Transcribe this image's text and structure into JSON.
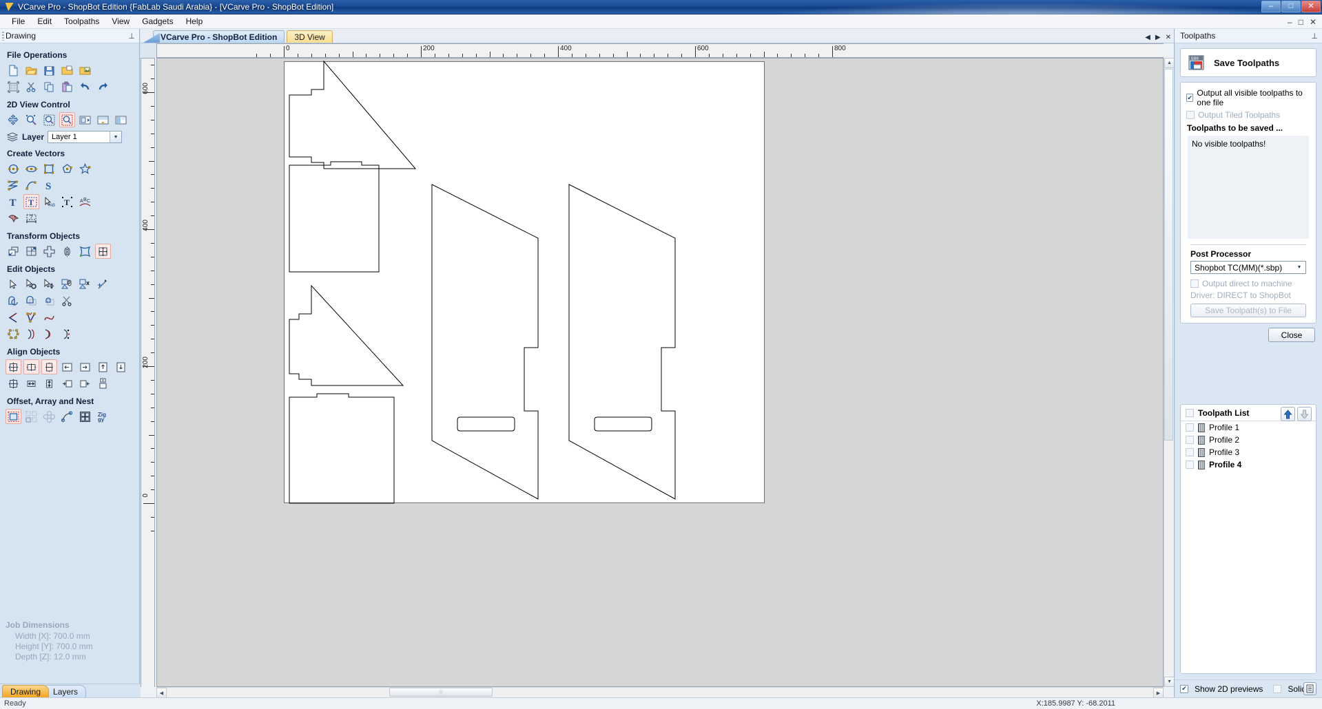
{
  "window": {
    "title": "VCarve Pro - ShopBot Edition {FabLab Saudi Arabia} - [VCarve Pro - ShopBot Edition]",
    "minimize": "–",
    "maximize": "□",
    "close": "✕",
    "inner_minimize": "–",
    "inner_maximize": "□",
    "inner_close": "✕"
  },
  "menu": {
    "items": [
      "File",
      "Edit",
      "Toolpaths",
      "View",
      "Gadgets",
      "Help"
    ]
  },
  "left_dock": {
    "title": "Drawing",
    "pin": "⊥",
    "groups": [
      {
        "title": "File Operations",
        "icons": [
          "new-file-icon",
          "open-folder-icon",
          "save-disk-icon",
          "import-folder-icon",
          "import-image-icon",
          "job-setup-icon",
          "cut-scissors-icon",
          "copy-icon",
          "paste-icon",
          "undo-icon",
          "redo-icon"
        ]
      },
      {
        "title": "2D View Control",
        "icons": [
          "pan-icon",
          "zoom-icon",
          "zoom-extents-icon",
          "zoom-box-icon",
          "zoom-selected-icon",
          "zoom-material-icon",
          "zoom-drawing-icon"
        ]
      },
      {
        "title": "Create Vectors",
        "icons": [
          "circle-icon",
          "ellipse-icon",
          "rectangle-icon",
          "polygon-icon",
          "star-icon",
          "polyline-icon",
          "curve-icon",
          "sweep-icon",
          "text-icon",
          "text-box-icon",
          "text-select-icon",
          "text-on-curve-icon",
          "text-arc-icon",
          "trace-bitmap-icon",
          "dimension-icon"
        ]
      },
      {
        "title": "Transform Objects",
        "icons": [
          "move-icon",
          "scale-icon",
          "rotate-icon",
          "mirror-icon",
          "distort-icon",
          "align-center-icon"
        ]
      },
      {
        "title": "Edit Objects",
        "icons": [
          "select-icon",
          "node-edit-icon",
          "move-node-icon",
          "group-icon",
          "ungroup-icon",
          "measure-icon",
          "weld-icon",
          "subtract-icon",
          "intersect-icon",
          "trim-icon",
          "join-vectors-icon",
          "fit-curves-icon",
          "curve-fit-icon",
          "close-vectors-icon",
          "offset-open-icon",
          "offset-curve-icon",
          "split-vector-icon"
        ]
      },
      {
        "title": "Align Objects",
        "icons": [
          "align-center-both-icon",
          "align-center-horiz-icon",
          "align-center-vert-icon",
          "align-left-icon",
          "align-right-icon",
          "align-top-icon",
          "align-bottom-icon",
          "align-mat-center-icon",
          "align-mat-horiz-icon",
          "align-mat-vert-icon",
          "align-outside-left-icon",
          "align-outside-right-icon",
          "align-outside-top-icon"
        ]
      },
      {
        "title": "Offset, Array and Nest",
        "icons": [
          "offset-icon",
          "array-copy-icon",
          "circular-array-icon",
          "copy-along-curve-icon",
          "block-copy-icon",
          "nesting-icon"
        ]
      }
    ],
    "layer": {
      "label": "Layer",
      "value": "Layer 1",
      "icon": "layers-icon"
    },
    "job_dimensions": {
      "title": "Job Dimensions",
      "width": "Width  [X]: 700.0 mm",
      "height": "Height [Y]: 700.0 mm",
      "depth": "Depth  [Z]: 12.0 mm"
    },
    "tabs": [
      {
        "label": "Drawing",
        "active": true
      },
      {
        "label": "Layers",
        "active": false
      }
    ]
  },
  "center": {
    "tabs": [
      {
        "label": "VCarve Pro - ShopBot Edition",
        "style": "active"
      },
      {
        "label": "3D View",
        "style": "yellow"
      }
    ],
    "tab_nav": [
      "◀",
      "▶",
      "✕"
    ],
    "ruler_h": {
      "labels": [
        "0",
        "200",
        "400",
        "600",
        "800"
      ],
      "unit": "mm"
    },
    "ruler_v": {
      "labels": [
        "600",
        "400",
        "200",
        "0"
      ],
      "unit": "mm"
    },
    "hscroll_thumb": "⦙⦙⦙",
    "vscroll_up": "▲",
    "vscroll_down": "▼",
    "hscroll_left": "◀",
    "hscroll_right": "▶"
  },
  "right_dock": {
    "title": "Toolpaths",
    "pin": "⊥",
    "save_toolpaths": {
      "label": "Save Toolpaths",
      "icon": "save-toolpaths-icon"
    },
    "options": {
      "output_all": {
        "label": "Output all visible toolpaths to one file",
        "checked": true,
        "enabled": true
      },
      "output_tiled": {
        "label": "Output Tiled Toolpaths",
        "checked": false,
        "enabled": false
      },
      "to_be_saved_label": "Toolpaths to be saved ...",
      "list_empty_msg": "No visible toolpaths!"
    },
    "post_processor": {
      "label": "Post Processor",
      "value": "Shopbot TC(MM)(*.sbp)",
      "output_direct": {
        "label": "Output direct to machine",
        "checked": false
      },
      "driver": "Driver: DIRECT to ShopBot",
      "save_button": "Save Toolpath(s) to File"
    },
    "close_button": "Close",
    "toolpath_list": {
      "title": "Toolpath List",
      "header_checked": false,
      "move_up_icon": "arrow-up-icon",
      "move_down_icon": "arrow-down-icon",
      "items": [
        {
          "label": "Profile 1",
          "checked": false,
          "bold": false
        },
        {
          "label": "Profile 2",
          "checked": false,
          "bold": false
        },
        {
          "label": "Profile 3",
          "checked": false,
          "bold": false
        },
        {
          "label": "Profile 4",
          "checked": false,
          "bold": true
        }
      ]
    },
    "footer": {
      "show_2d_previews": {
        "label": "Show 2D previews",
        "checked": true
      },
      "solid": {
        "label": "Solid",
        "checked": false
      },
      "preview_icon": "preview-panel-icon"
    }
  },
  "status_bar": {
    "message": "Ready",
    "coords": "X:185.9987 Y: -68.2011"
  }
}
